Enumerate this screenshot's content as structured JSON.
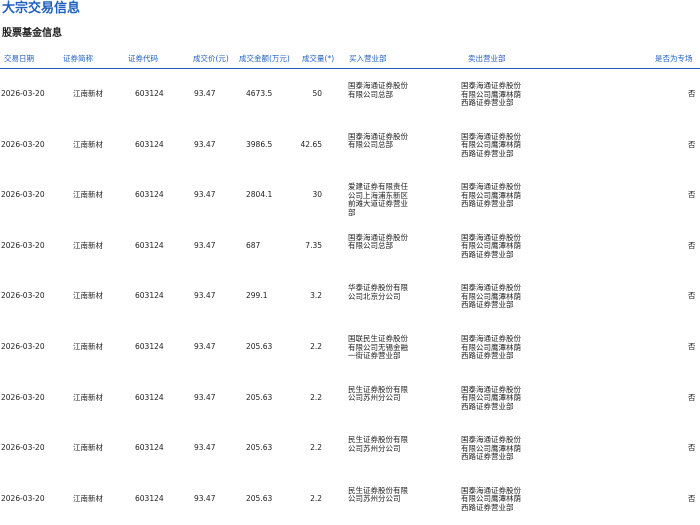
{
  "page": {
    "title": "大宗交易信息",
    "section_title": "股票基金信息"
  },
  "table": {
    "headers": [
      "交易日期",
      "证券简称",
      "证券代码",
      "成交价(元)",
      "成交金额(万元)",
      "成交量(",
      "*",
      ")",
      "买入营业部",
      "卖出营业部",
      "是否为专场"
    ],
    "rows": [
      {
        "date": "2026-03-20",
        "name": "江南新材",
        "code": "603124",
        "price": "93.47",
        "amount": "4673.5",
        "volume": "50",
        "buy": "国泰海通证券股份有限公司总部",
        "sell": "国泰海通证券股份有限公司鹰潭林荫西路证券营业部",
        "special": "否"
      },
      {
        "date": "2026-03-20",
        "name": "江南新材",
        "code": "603124",
        "price": "93.47",
        "amount": "3986.5",
        "volume": "42.65",
        "buy": "国泰海通证券股份有限公司总部",
        "sell": "国泰海通证券股份有限公司鹰潭林荫西路证券营业部",
        "special": "否"
      },
      {
        "date": "2026-03-20",
        "name": "江南新材",
        "code": "603124",
        "price": "93.47",
        "amount": "2804.1",
        "volume": "30",
        "buy": "爱建证券有限责任公司上海浦东新区前滩大道证券营业部",
        "sell": "国泰海通证券股份有限公司鹰潭林荫西路证券营业部",
        "special": "否"
      },
      {
        "date": "2026-03-20",
        "name": "江南新材",
        "code": "603124",
        "price": "93.47",
        "amount": "687",
        "volume": "7.35",
        "buy": "国泰海通证券股份有限公司总部",
        "sell": "国泰海通证券股份有限公司鹰潭林荫西路证券营业部",
        "special": "否"
      },
      {
        "date": "2026-03-20",
        "name": "江南新材",
        "code": "603124",
        "price": "93.47",
        "amount": "299.1",
        "volume": "3.2",
        "buy": "华泰证券股份有限公司北京分公司",
        "sell": "国泰海通证券股份有限公司鹰潭林荫西路证券营业部",
        "special": "否"
      },
      {
        "date": "2026-03-20",
        "name": "江南新材",
        "code": "603124",
        "price": "93.47",
        "amount": "205.63",
        "volume": "2.2",
        "buy": "国联民生证券股份有限公司无锡金融一街证券营业部",
        "sell": "国泰海通证券股份有限公司鹰潭林荫西路证券营业部",
        "special": "否"
      },
      {
        "date": "2026-03-20",
        "name": "江南新材",
        "code": "603124",
        "price": "93.47",
        "amount": "205.63",
        "volume": "2.2",
        "buy": "民生证券股份有限公司苏州分公司",
        "sell": "国泰海通证券股份有限公司鹰潭林荫西路证券营业部",
        "special": "否"
      },
      {
        "date": "2026-03-20",
        "name": "江南新材",
        "code": "603124",
        "price": "93.47",
        "amount": "205.63",
        "volume": "2.2",
        "buy": "民生证券股份有限公司苏州分公司",
        "sell": "国泰海通证券股份有限公司鹰潭林荫西路证券营业部",
        "special": "否"
      },
      {
        "date": "2026-03-20",
        "name": "江南新材",
        "code": "603124",
        "price": "93.47",
        "amount": "205.63",
        "volume": "2.2",
        "buy": "民生证券股份有限公司苏州分公司",
        "sell": "国泰海通证券股份有限公司鹰潭林荫西路证券营业部",
        "special": "否"
      }
    ]
  }
}
